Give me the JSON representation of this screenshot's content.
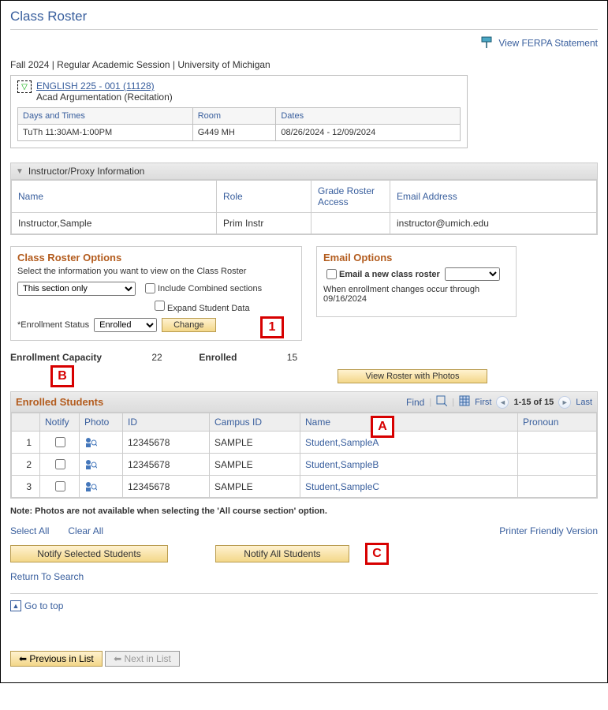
{
  "page": {
    "title": "Class Roster"
  },
  "ferpa": {
    "label": "View FERPA Statement"
  },
  "session_line": "Fall 2024 | Regular Academic Session | University of Michigan",
  "class": {
    "title": "ENGLISH 225 - 001 (11128)",
    "subtitle": "Acad Argumentation (Recitation)",
    "headers": {
      "days": "Days and Times",
      "room": "Room",
      "dates": "Dates"
    },
    "days": "TuTh 11:30AM-1:00PM",
    "room": "G449 MH",
    "dates": "08/26/2024 - 12/09/2024"
  },
  "instructor": {
    "section_title": "Instructor/Proxy Information",
    "headers": {
      "name": "Name",
      "role": "Role",
      "access": "Grade Roster Access",
      "email": "Email Address"
    },
    "name": "Instructor,Sample",
    "role": "Prim Instr",
    "access": "",
    "email": "instructor@umich.edu"
  },
  "options": {
    "title": "Class Roster Options",
    "intro": "Select the information you want to view on the Class Roster",
    "section_select": "This section only",
    "include_combined": "Include Combined sections",
    "expand_student": "Expand Student Data",
    "enrollment_status_label": "*Enrollment Status",
    "enrollment_status_value": "Enrolled",
    "change_label": "Change"
  },
  "email": {
    "title": "Email Options",
    "checkbox_label": "Email a new class roster",
    "line": "When enrollment changes occur through 09/16/2024"
  },
  "callouts": {
    "one": "1",
    "A": "A",
    "B": "B",
    "C": "C"
  },
  "caps": {
    "capacity_label": "Enrollment Capacity",
    "capacity_value": "22",
    "enrolled_label": "Enrolled",
    "enrolled_value": "15"
  },
  "view_photos_label": "View Roster with Photos",
  "roster": {
    "title": "Enrolled Students",
    "find_label": "Find",
    "first_label": "First",
    "range_label": "1-15 of 15",
    "last_label": "Last",
    "cols": {
      "notify": "Notify",
      "photo": "Photo",
      "id": "ID",
      "campus": "Campus ID",
      "name": "Name",
      "pronoun": "Pronoun"
    },
    "rows": [
      {
        "n": "1",
        "id": "12345678",
        "campus": "SAMPLE",
        "name": "Student,SampleA",
        "pronoun": ""
      },
      {
        "n": "2",
        "id": "12345678",
        "campus": "SAMPLE",
        "name": "Student,SampleB",
        "pronoun": ""
      },
      {
        "n": "3",
        "id": "12345678",
        "campus": "SAMPLE",
        "name": "Student,SampleC",
        "pronoun": ""
      }
    ]
  },
  "note": "Note: Photos are not available when selecting the 'All course section' option.",
  "select_all": "Select All",
  "clear_all": "Clear All",
  "printer": "Printer Friendly Version",
  "notify_selected": "Notify Selected Students",
  "notify_all": "Notify All Students",
  "return_search": "Return To Search",
  "go_top": "Go to top",
  "prev": "⬅   Previous in List",
  "next": "⬅   Next in List"
}
